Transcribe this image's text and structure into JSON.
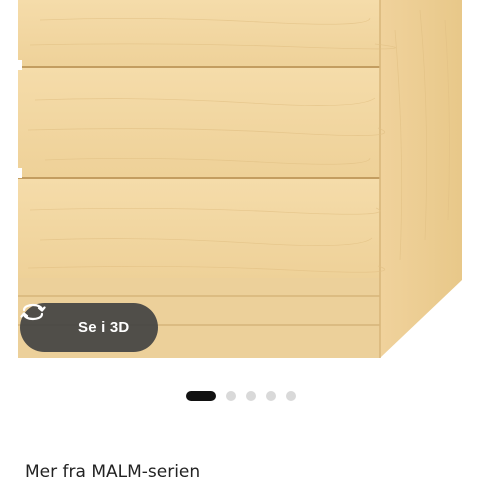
{
  "gallery": {
    "view_3d_label": "Se i 3D",
    "view_3d_icon": "rotate-3d-icon",
    "wood_color": "#f2d6a0",
    "dot_count": 5,
    "active_dot": 0
  },
  "section": {
    "more_series_label": "Mer fra MALM-serien"
  }
}
